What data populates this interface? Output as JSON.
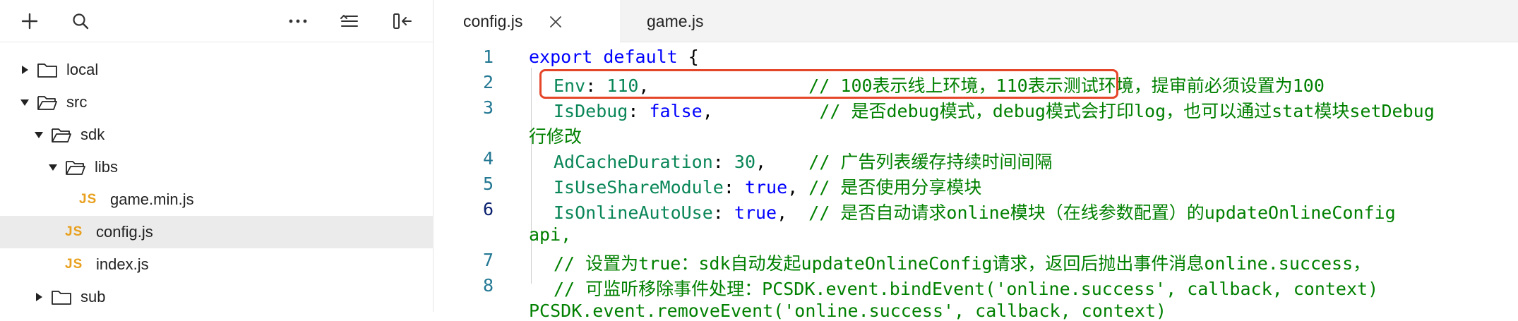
{
  "sidebar": {
    "toolbar": {
      "add": "+",
      "more": "···"
    },
    "tree": [
      {
        "label": "local",
        "type": "folder",
        "expanded": false,
        "depth": 0
      },
      {
        "label": "src",
        "type": "folder",
        "expanded": true,
        "depth": 0
      },
      {
        "label": "sdk",
        "type": "folder",
        "expanded": true,
        "depth": 1
      },
      {
        "label": "libs",
        "type": "folder",
        "expanded": true,
        "depth": 2
      },
      {
        "label": "game.min.js",
        "type": "js",
        "depth": 3
      },
      {
        "label": "config.js",
        "type": "js",
        "depth": 2,
        "selected": true
      },
      {
        "label": "index.js",
        "type": "js",
        "depth": 2
      },
      {
        "label": "sub",
        "type": "folder",
        "expanded": false,
        "depth": 1
      }
    ],
    "js_badge": "JS"
  },
  "editor": {
    "tabs": [
      {
        "label": "config.js",
        "active": true
      },
      {
        "label": "game.js",
        "active": false
      }
    ],
    "line_numbers": [
      "1",
      "2",
      "3",
      "4",
      "5",
      "6",
      "7",
      "8"
    ],
    "code": {
      "l1_kw": "export default",
      "l1_rest": " {",
      "l2_prop": "Env",
      "l2_punct": ": ",
      "l2_val": "110",
      "l2_pad": ",               ",
      "l2_comment": "// 100表示线上环境，110表示测试环境，提审前必须设置为100",
      "l3_prop": "IsDebug",
      "l3_punct": ": ",
      "l3_val": "false",
      "l3_pad": ",          ",
      "l3_comment": "// 是否debug模式，debug模式会打印log，也可以通过stat模块setDebug",
      "l3_wrap": "行修改",
      "l4_prop": "AdCacheDuration",
      "l4_punct": ": ",
      "l4_val": "30",
      "l4_pad": ",    ",
      "l4_comment": "// 广告列表缓存持续时间间隔",
      "l5_prop": "IsUseShareModule",
      "l5_punct": ": ",
      "l5_val": "true",
      "l5_pad": ", ",
      "l5_comment": "// 是否使用分享模块",
      "l6_prop": "IsOnlineAutoUse",
      "l6_punct": ": ",
      "l6_val": "true",
      "l6_pad": ",  ",
      "l6_comment": "// 是否自动请求online模块（在线参数配置）的updateOnlineConfig",
      "l6_wrap": "api,",
      "l7_comment": "// 设置为true：sdk自动发起updateOnlineConfig请求，返回后抛出事件消息online.success，",
      "l8_comment": "// 可监听移除事件处理：PCSDK.event.bindEvent('online.success', callback, context)",
      "l8_wrap": "PCSDK.event.removeEvent('online.success', callback, context)"
    },
    "colors": {
      "keyword": "#0000ff",
      "property": "#098658",
      "comment": "#008000",
      "line_number": "#237893",
      "highlight_box": "#e5462a"
    }
  }
}
